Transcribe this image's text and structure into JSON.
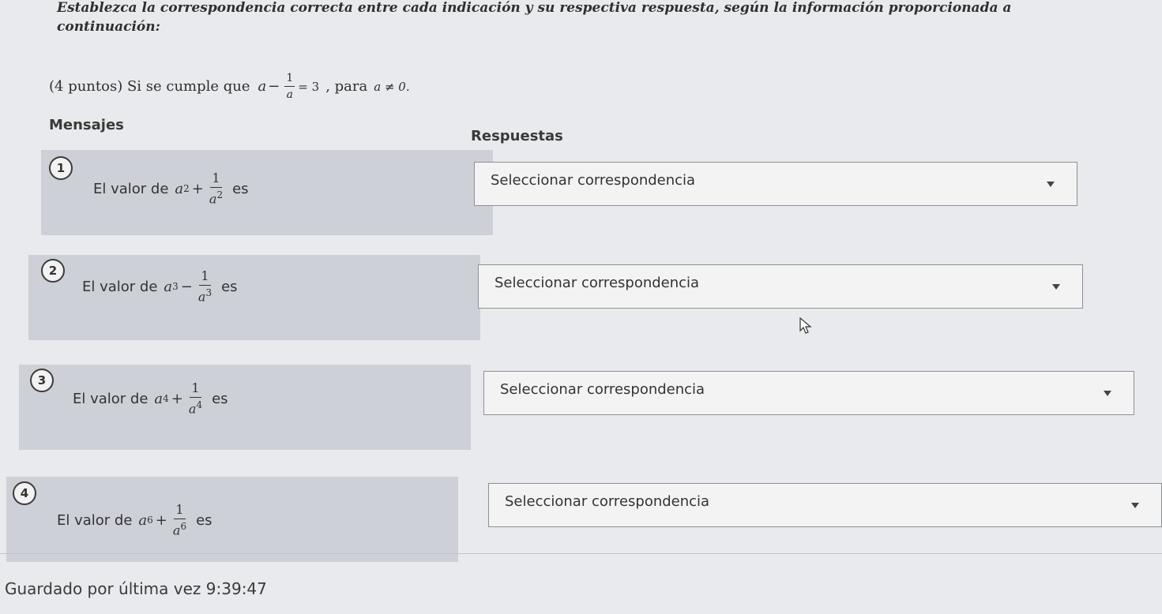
{
  "instructions": "Establezca la correspondencia correcta entre cada indicación y su respectiva respuesta, según la información proporcionada a continuación:",
  "statement": {
    "prefix": "(4 puntos) Si se cumple que",
    "eq_a": "a",
    "eq_minus": "−",
    "eq_num": "1",
    "eq_den": "a",
    "eq_rhs": "= 3",
    "middle": ", para",
    "cond": "a ≠ 0."
  },
  "headers": {
    "mensajes": "Mensajes",
    "respuestas": "Respuestas"
  },
  "items": [
    {
      "number": "1",
      "prefix": "El valor de",
      "base": "a",
      "exp": "2",
      "op": "+",
      "num": "1",
      "den_base": "a",
      "den_exp": "2",
      "suffix": "es",
      "select_label": "Seleccionar correspondencia"
    },
    {
      "number": "2",
      "prefix": "El valor de",
      "base": "a",
      "exp": "3",
      "op": "−",
      "num": "1",
      "den_base": "a",
      "den_exp": "3",
      "suffix": "es",
      "select_label": "Seleccionar correspondencia"
    },
    {
      "number": "3",
      "prefix": "El valor de",
      "base": "a",
      "exp": "4",
      "op": "+",
      "num": "1",
      "den_base": "a",
      "den_exp": "4",
      "suffix": "es",
      "select_label": "Seleccionar correspondencia"
    },
    {
      "number": "4",
      "prefix": "El valor de",
      "base": "a",
      "exp": "6",
      "op": "+",
      "num": "1",
      "den_base": "a",
      "den_exp": "6",
      "suffix": "es",
      "select_label": "Seleccionar correspondencia"
    }
  ],
  "footer": {
    "saved": "Guardado por última vez 9:39:47"
  }
}
